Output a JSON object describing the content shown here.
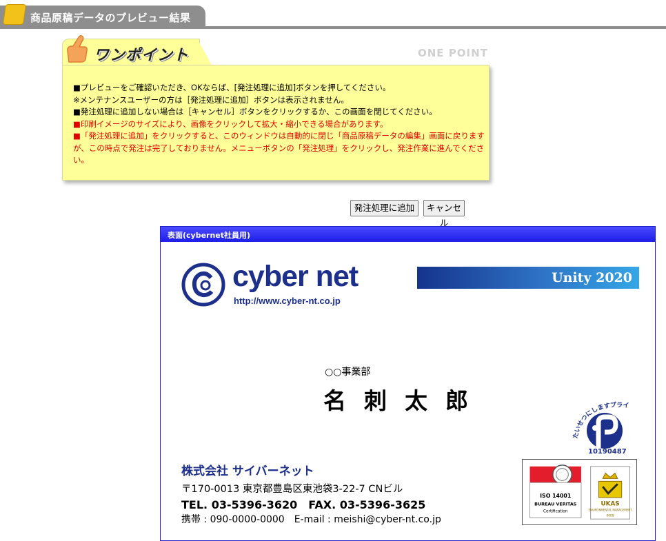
{
  "header": {
    "title": "商品原稿データのプレビュー結果"
  },
  "onepoint": {
    "title": "ワンポイント",
    "title_en": "ONE POINT",
    "lines": [
      "■プレビューをご確認いただき、OKならば、[発注処理に追加]ボタンを押してください。",
      "※メンテナンスユーザーの方は［発注処理に追加］ボタンは表示されません。",
      "■発注処理に追加しない場合は［キャンセル］ボタンをクリックするか、この画面を閉じてください。",
      "■印刷イメージのサイズにより、画像をクリックして拡大・縮小できる場合があります。",
      "■「発注処理に追加」をクリックすると、このウィンドウは自動的に閉じ「商品原稿データの編集」画面に戻りますが、この時点で発注は完了しておりません。メニューボタンの「発注処理」をクリックし、発注作業に進んでください。"
    ]
  },
  "buttons": {
    "add_label": "発注処理に追加",
    "cancel_label": "キャンセル"
  },
  "card": {
    "header": "表面(cybernet社員用)",
    "logo_text": "cyber net",
    "logo_url": "http://www.cyber-nt.co.jp",
    "unity": "Unity 2020",
    "dept": "○○事業部",
    "name": "名刺太郎",
    "privacy_mark": "たいせつにしますプライバシー",
    "privacy_number": "10190487",
    "company": "株式会社 サイバーネット",
    "address": "〒170-0013 東京都豊島区東池袋3-22-7 CNビル",
    "tel": "TEL. 03-5396-3620　FAX. 03-5396-3625",
    "mobile": "携帯 : 090-0000-0000　E-mail : meishi@cyber-nt.co.jp",
    "iso_left": "ISO 14001",
    "iso_left_sub1": "BUREAU VERITAS",
    "iso_left_sub2": "Certification",
    "iso_right": "UKAS",
    "iso_right_sub": "ENVIRONMENTAL MANAGEMENT",
    "iso_right_num": "0008"
  },
  "colors": {
    "accent_navy": "#1c2f8a",
    "header_gray": "#8e8e8e",
    "note_yellow": "#ffff99",
    "warn_red": "#e00000",
    "card_border": "#2020c8"
  }
}
